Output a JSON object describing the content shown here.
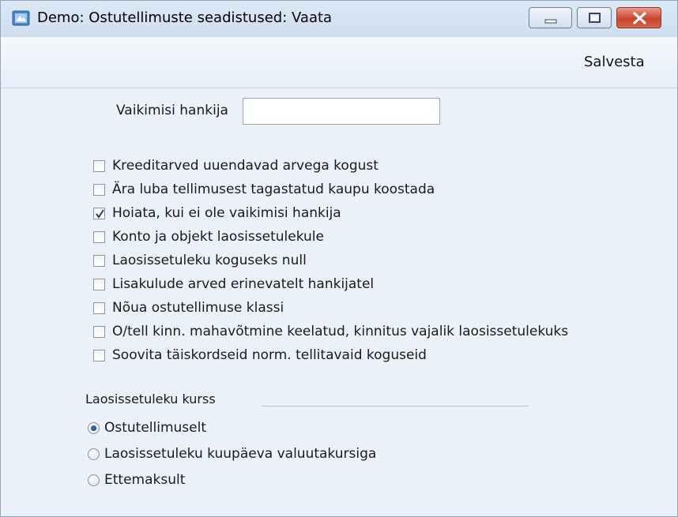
{
  "window": {
    "title": "Demo: Ostutellimuste seadistused: Vaata",
    "icon": "app-icon"
  },
  "toolbar": {
    "save_label": "Salvesta"
  },
  "form": {
    "default_supplier_label": "Vaikimisi hankija",
    "default_supplier_value": "",
    "checkboxes": [
      {
        "label": "Kreeditarved uuendavad arvega kogust",
        "checked": false
      },
      {
        "label": "Ära luba tellimusest tagastatud kaupu koostada",
        "checked": false
      },
      {
        "label": "Hoiata, kui ei ole vaikimisi hankija",
        "checked": true
      },
      {
        "label": "Konto ja objekt laosissetulekule",
        "checked": false
      },
      {
        "label": "Laosissetuleku koguseks null",
        "checked": false
      },
      {
        "label": "Lisakulude arved erinevatelt hankijatel",
        "checked": false
      },
      {
        "label": "Nõua ostutellimuse klassi",
        "checked": false
      },
      {
        "label": "O/tell kinn. mahavõtmine keelatud, kinnitus vajalik laosissetulekuks",
        "checked": false
      },
      {
        "label": "Soovita täiskordseid norm. tellitavaid koguseid",
        "checked": false
      }
    ],
    "rate_group": {
      "label": "Laosissetuleku kurss",
      "options": [
        {
          "label": "Ostutellimuselt",
          "selected": true
        },
        {
          "label": "Laosissetuleku kuupäeva valuutakursiga",
          "selected": false
        },
        {
          "label": "Ettemaksult",
          "selected": false
        }
      ]
    }
  }
}
